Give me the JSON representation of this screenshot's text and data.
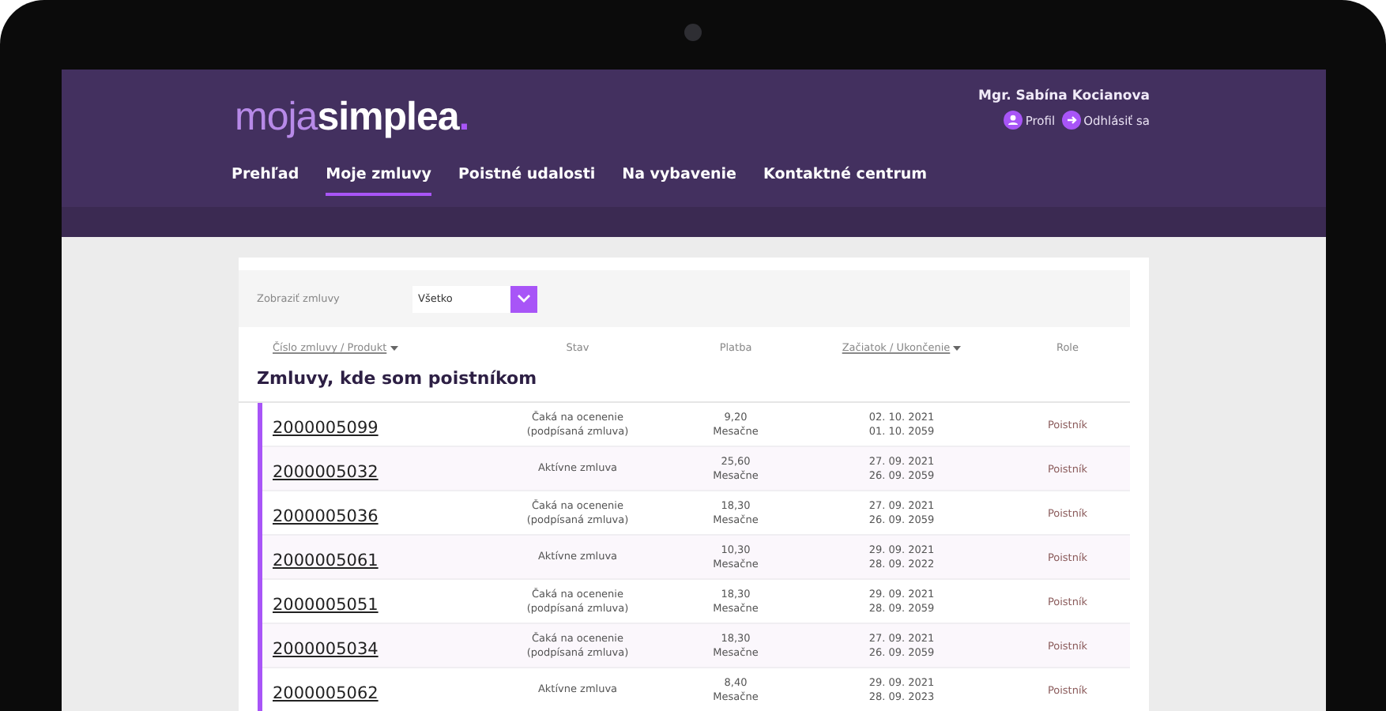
{
  "logo": {
    "light": "moja",
    "bold": "simplea",
    "dot": "."
  },
  "user": {
    "name": "Mgr. Sabína Kocianova",
    "links": [
      {
        "kind": "profile",
        "label": "Profil"
      },
      {
        "kind": "logout",
        "label": "Odhlásiť sa"
      }
    ]
  },
  "nav": [
    {
      "label": "Prehľad",
      "selected": false
    },
    {
      "label": "Moje zmluvy",
      "selected": true
    },
    {
      "label": "Poistné udalosti",
      "selected": false
    },
    {
      "label": "Na vybavenie",
      "selected": false
    },
    {
      "label": "Kontaktné centrum",
      "selected": false
    }
  ],
  "filter": {
    "label": "Zobraziť zmluvy",
    "value": "Všetko"
  },
  "table": {
    "columns": [
      {
        "label": "Číslo zmluvy / Produkt",
        "sortable": true
      },
      {
        "label": "Stav",
        "sortable": false
      },
      {
        "label": "Platba",
        "sortable": false
      },
      {
        "label": "Začiatok / Ukončenie",
        "sortable": true
      },
      {
        "label": "Role",
        "sortable": false
      }
    ],
    "section_title": "Zmluvy, kde som poistníkom",
    "rows": [
      {
        "number": "2000005099",
        "status": [
          "Čaká na ocenenie",
          "(podpísaná zmluva)"
        ],
        "amount": "9,20",
        "frequency": "Mesačne",
        "start": "02. 10. 2021",
        "end": "01. 10. 2059",
        "role": "Poistník"
      },
      {
        "number": "2000005032",
        "status": [
          "Aktívne zmluva"
        ],
        "amount": "25,60",
        "frequency": "Mesačne",
        "start": "27. 09. 2021",
        "end": "26. 09. 2059",
        "role": "Poistník"
      },
      {
        "number": "2000005036",
        "status": [
          "Čaká na ocenenie",
          "(podpísaná zmluva)"
        ],
        "amount": "18,30",
        "frequency": "Mesačne",
        "start": "27. 09. 2021",
        "end": "26. 09. 2059",
        "role": "Poistník"
      },
      {
        "number": "2000005061",
        "status": [
          "Aktívne zmluva"
        ],
        "amount": "10,30",
        "frequency": "Mesačne",
        "start": "29. 09. 2021",
        "end": "28. 09. 2022",
        "role": "Poistník"
      },
      {
        "number": "2000005051",
        "status": [
          "Čaká na ocenenie",
          "(podpísaná zmluva)"
        ],
        "amount": "18,30",
        "frequency": "Mesačne",
        "start": "29. 09. 2021",
        "end": "28. 09. 2059",
        "role": "Poistník"
      },
      {
        "number": "2000005034",
        "status": [
          "Čaká na ocenenie",
          "(podpísaná zmluva)"
        ],
        "amount": "18,30",
        "frequency": "Mesačne",
        "start": "27. 09. 2021",
        "end": "26. 09. 2059",
        "role": "Poistník"
      },
      {
        "number": "2000005062",
        "status": [
          "Aktívne zmluva"
        ],
        "amount": "8,40",
        "frequency": "Mesačne",
        "start": "29. 09. 2021",
        "end": "28. 09. 2023",
        "role": "Poistník"
      }
    ]
  }
}
